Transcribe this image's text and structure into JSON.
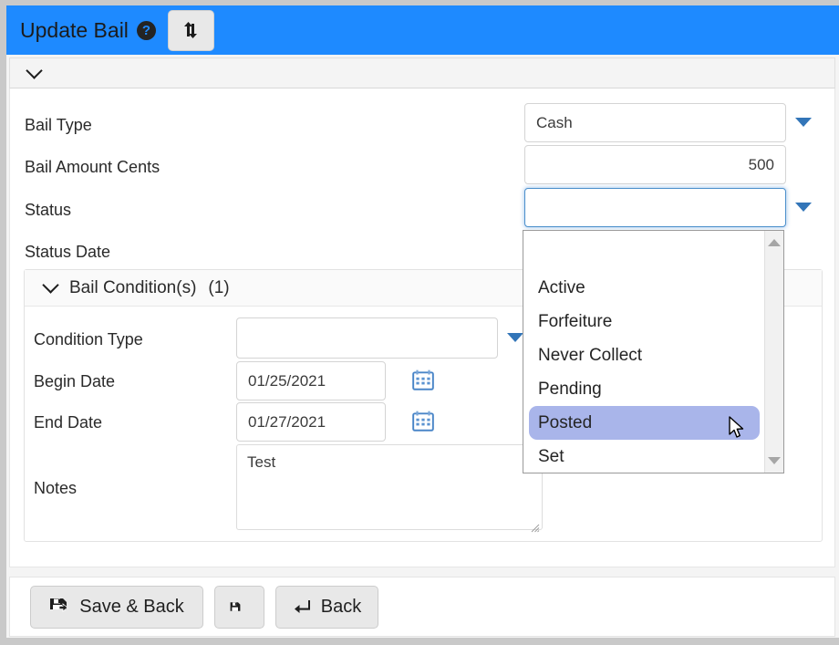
{
  "window": {
    "title": "Update Bail",
    "help_icon": "question-mark-icon",
    "swap_icon": "swap-arrows-icon",
    "header_color": "#1e8aff"
  },
  "toolbar": {
    "collapse_icon": "chevron-down-icon"
  },
  "form": {
    "fields": [
      {
        "label": "Bail Type",
        "value": "Cash",
        "type": "select",
        "placeholder": ""
      },
      {
        "label": "Bail Amount Cents",
        "value": "500",
        "type": "number",
        "placeholder": ""
      },
      {
        "label": "Status",
        "value": "",
        "type": "select",
        "placeholder": ""
      },
      {
        "label": "Status Date",
        "value": "",
        "type": "date",
        "placeholder": ""
      }
    ]
  },
  "conditions_panel": {
    "collapse_icon": "chevron-down-icon",
    "title": "Bail Condition(s)",
    "count": "(1)",
    "fields": {
      "condition_type_label": "Condition Type",
      "condition_type_value": "",
      "begin_date_label": "Begin Date",
      "begin_date_value": "01/25/2021",
      "end_date_label": "End Date",
      "end_date_value": "01/27/2021",
      "notes_label": "Notes",
      "notes_value": "Test"
    },
    "calendar_icon": "calendar-icon"
  },
  "status_dropdown": {
    "open": true,
    "selected": "Posted",
    "highlight_color": "#a9b5ea",
    "options": [
      "Active",
      "Forfeiture",
      "Never Collect",
      "Pending",
      "Posted",
      "Set"
    ],
    "scroll_up_icon": "scroll-up-arrow-icon",
    "scroll_down_icon": "scroll-down-arrow-icon"
  },
  "footer": {
    "buttons": [
      {
        "label": "Save & Back",
        "icon": "save-and-back-icon"
      },
      {
        "label": "",
        "icon": "floppy-disk-save-icon"
      },
      {
        "label": "Back",
        "icon": "back-arrow-icon"
      }
    ]
  }
}
